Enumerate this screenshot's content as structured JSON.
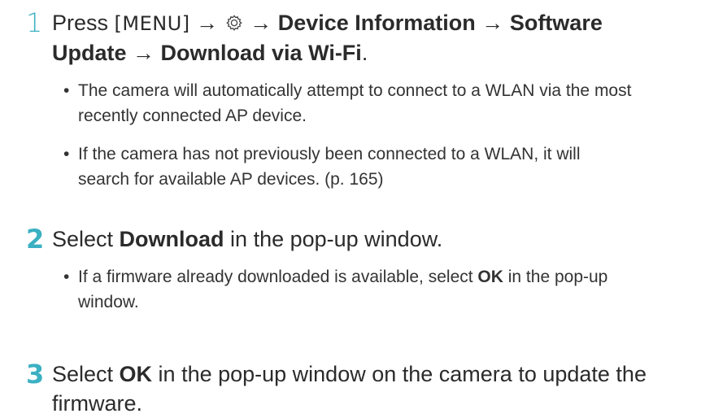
{
  "steps": [
    {
      "number": "1",
      "line1_prefix": "Press ",
      "menu_key": "[MENU]",
      "arrow": "→",
      "settings_icon": "gear-icon",
      "path1": "Device Information",
      "path2": "Software Update",
      "path3": "Download via Wi-Fi",
      "period": ".",
      "bullets": [
        "The camera will automatically attempt to connect to a WLAN via the most recently connected AP device.",
        "If the camera has not previously been connected to a WLAN, it will search for available AP devices. (p. 165)"
      ]
    },
    {
      "number": "2",
      "prefix": "Select ",
      "bold": "Download",
      "suffix": " in the pop-up window.",
      "bullets": [
        {
          "prefix": "If a firmware already downloaded is available, select ",
          "bold": "OK",
          "suffix": " in the pop-up window."
        }
      ]
    },
    {
      "number": "3",
      "prefix": "Select ",
      "bold": "OK",
      "suffix": " in the pop-up window on the camera to update the firmware."
    }
  ],
  "bullet_glyph": "•",
  "accent_color": "#3bb0c2"
}
